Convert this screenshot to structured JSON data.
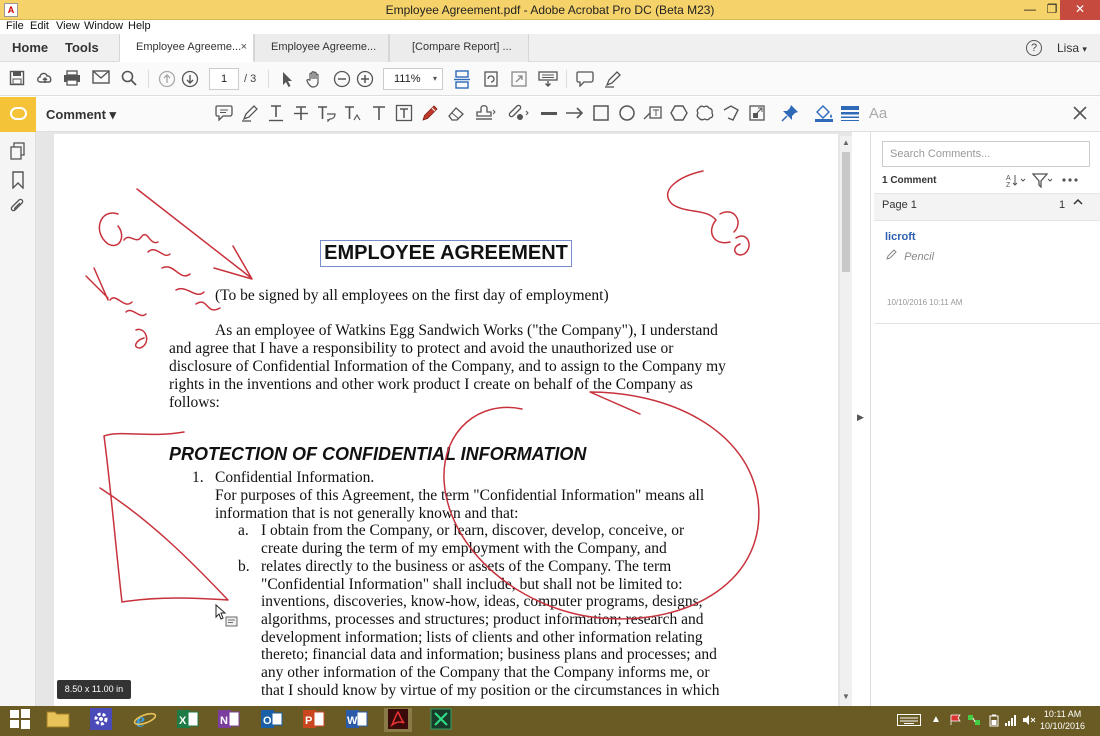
{
  "window": {
    "title": "Employee Agreement.pdf - Adobe Acrobat Pro DC (Beta M23)",
    "minimize": "—",
    "maximize": "❐",
    "close": "✕"
  },
  "menu": [
    "File",
    "Edit",
    "View",
    "Window",
    "Help"
  ],
  "nav": {
    "home": "Home",
    "tools": "Tools"
  },
  "tabs": [
    {
      "label": "Employee Agreeme...",
      "close": "×"
    },
    {
      "label": "Employee Agreeme..."
    },
    {
      "label": "[Compare Report] ..."
    }
  ],
  "user": {
    "name": "Lisa",
    "caret": "▾",
    "help": "?"
  },
  "toolbar": {
    "page_current": "1",
    "page_total": "/ 3",
    "zoom": "111%",
    "zoom_caret": "▾"
  },
  "comment_toolbar": {
    "label": "Comment ▾",
    "text_style": "Aa"
  },
  "document": {
    "title": "EMPLOYEE AGREEMENT",
    "subtitle": "(To be signed by all employees on the first day of employment)",
    "intro": [
      "As an employee of Watkins Egg Sandwich Works (\"the Company\"), I understand",
      "and agree that I have a responsibility to protect and avoid the unauthorized use or",
      "disclosure of Confidential Information of the Company, and to assign to the Company my",
      "rights in the inventions and other work product I create on behalf of the Company as",
      "follows:"
    ],
    "section": "PROTECTION OF CONFIDENTIAL INFORMATION",
    "item_number": "1.",
    "item_title": "Confidential Information.",
    "item_body": [
      "For purposes of this Agreement, the term \"Confidential Information\" means all",
      "information that is not generally known and that:"
    ],
    "sub_a_marker": "a.",
    "sub_a": [
      "I obtain from the Company, or learn, discover, develop, conceive, or",
      "create during the term of my employment with the Company, and"
    ],
    "sub_b_marker": "b.",
    "sub_b": [
      "relates directly to the business or assets of the Company.  The term",
      "\"Confidential Information\" shall include, but shall not be limited to:",
      "inventions, discoveries, know-how, ideas, computer programs, designs,",
      "algorithms, processes and structures; product information; research and",
      "development information; lists of clients and other information relating",
      "thereto; financial data and information; business plans and processes; and",
      "any other information of the Company that the Company informs me, or",
      "that I should know by virtue of my position or the circumstances in which"
    ],
    "page_size_tip": "8.50 x 11.00 in"
  },
  "comments_pane": {
    "search_placeholder": "Search Comments...",
    "count": "1 Comment",
    "page_label": "Page 1",
    "page_count": "1",
    "comment": {
      "author": "licroft",
      "type": "Pencil",
      "date": "10/10/2016  10:11 AM"
    }
  },
  "taskbar": {
    "clock_time": "10:11 AM",
    "clock_date": "10/10/2016"
  },
  "colors": {
    "titlebar": "#f6d36a",
    "ink": "#c8323c",
    "accent_blue": "#2d5fb0",
    "comment_yellow": "#f4c338",
    "taskbar": "#6a5a24"
  }
}
